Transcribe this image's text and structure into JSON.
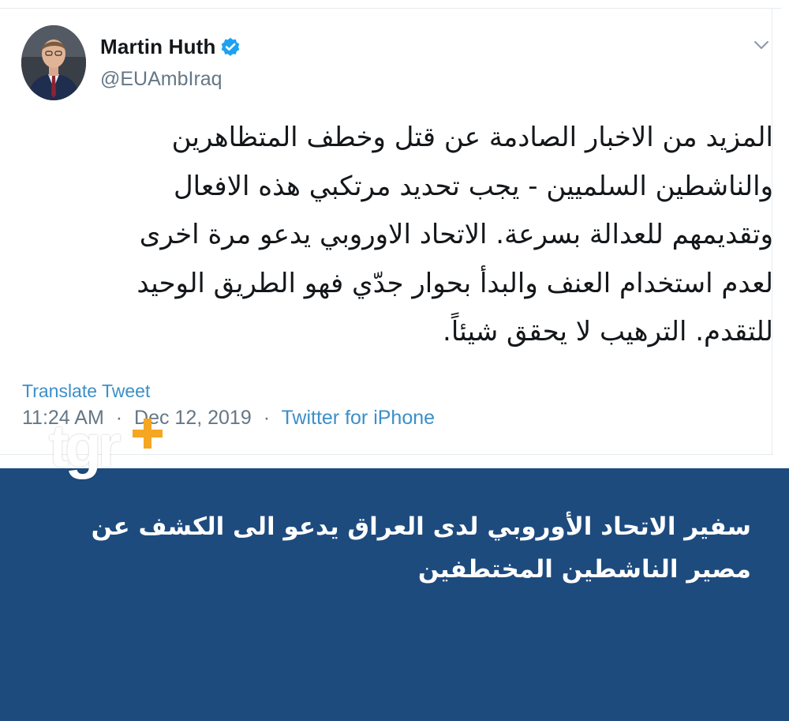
{
  "tweet": {
    "author": {
      "display_name": "Martin Huth",
      "handle": "@EUAmbIraq",
      "verified": true,
      "avatar_icon": "person-portrait-avatar"
    },
    "menu_icon": "chevron-down-icon",
    "body_lines": [
      "المزيد من الاخبار الصادمة عن قتل وخطف المتظاهرين",
      "والناشطين السلميين - يجب تحديد مرتكبي هذه الافعال",
      "وتقديمهم للعدالة بسرعة. الاتحاد الاوروبي يدعو مرة اخرى",
      "لعدم استخدام العنف والبدأ بحوار جدّي فهو الطريق الوحيد",
      "للتقدم. الترهيب لا يحقق شيئاً."
    ],
    "translate_label": "Translate Tweet",
    "time": "11:24 AM",
    "date": "Dec 12, 2019",
    "separator": "·",
    "source": "Twitter for iPhone"
  },
  "logo": {
    "text": "tgr",
    "plus_icon": "plus-icon",
    "plus_color": "#f5a623"
  },
  "headline": {
    "lines": [
      "سفير الاتحاد الأوروبي لدى العراق يدعو الى الكشف عن",
      "مصير الناشطين المختطفين"
    ]
  },
  "colors": {
    "banner": "#1d4b7e",
    "link": "#3b8fc9",
    "verified": "#1da1f2",
    "muted": "#657786",
    "text": "#14171a"
  }
}
